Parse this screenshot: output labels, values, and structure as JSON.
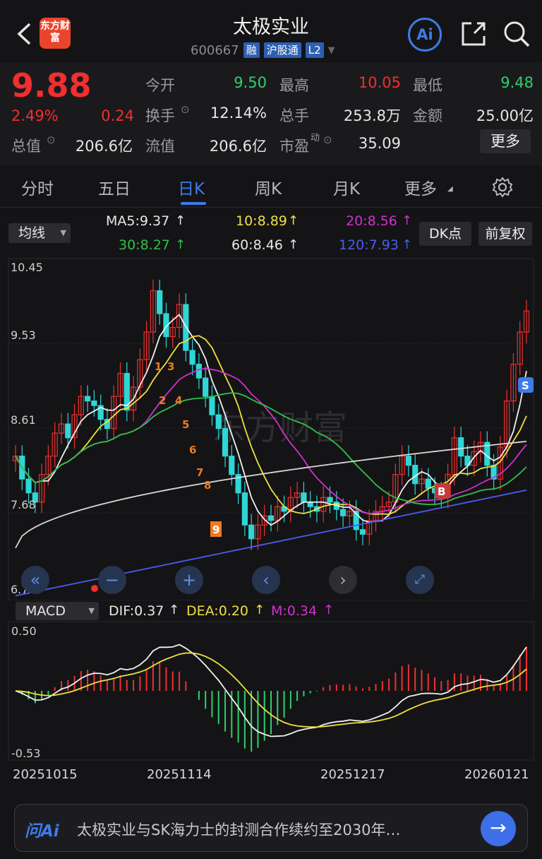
{
  "header": {
    "title": "太极实业",
    "code": "600667",
    "tags": [
      "融",
      "沪股通",
      "L2"
    ],
    "logo": "东方财富",
    "ai_label": "Ai"
  },
  "quote": {
    "price": "9.88",
    "change_pct": "2.49%",
    "change": "0.24",
    "open_label": "今开",
    "open": "9.50",
    "high_label": "最高",
    "high": "10.05",
    "low_label": "最低",
    "low": "9.48",
    "turnover_label": "换手",
    "turnover": "12.14%",
    "volume_label": "总手",
    "volume": "253.8万",
    "amount_label": "金额",
    "amount": "25.00亿",
    "mcap_label": "总值",
    "mcap": "206.6亿",
    "float_label": "流值",
    "float": "206.6亿",
    "pe_label": "市盈",
    "pe_sup": "动",
    "pe": "35.09",
    "more": "更多"
  },
  "tabs": [
    "分时",
    "五日",
    "日K",
    "周K",
    "月K",
    "更多"
  ],
  "ma_selector": "均线",
  "ma": {
    "ma5": "MA5:9.37",
    "ma10": "10:8.89",
    "ma20": "20:8.56",
    "ma30": "30:8.27",
    "ma60": "60:8.46",
    "ma120": "120:7.93"
  },
  "buttons": {
    "dk": "DK点",
    "fq": "前复权"
  },
  "kchart": {
    "yticks": [
      "10.45",
      "9.53",
      "8.61",
      "7.68",
      "6.76"
    ],
    "signals": [
      "1",
      "2",
      "3",
      "4",
      "5",
      "6",
      "7",
      "8",
      "9"
    ],
    "buy": "B",
    "sell": "S",
    "watermark": "东方财富"
  },
  "macd": {
    "selector": "MACD",
    "dif": "DIF:0.37",
    "dea": "DEA:0.20",
    "m": "M:0.34",
    "ytop": "0.50",
    "ybot": "-0.53"
  },
  "dates": [
    "20251015",
    "20251114",
    "20251217",
    "20260121"
  ],
  "ai": {
    "logo": "问Ai",
    "text": "太极实业与SK海力士的封测合作续约至2030年…"
  },
  "colors": {
    "up": "#f02f2f",
    "down": "#2fd6d6",
    "accent": "#3d7be8"
  },
  "chart_data": {
    "type": "candlestick",
    "x_start": "20251015",
    "x_end": "20260121",
    "ylim": [
      6.76,
      10.45
    ],
    "closes": [
      8.3,
      8.05,
      7.9,
      7.8,
      8.1,
      8.3,
      8.55,
      8.65,
      8.5,
      8.75,
      8.95,
      8.9,
      8.85,
      8.7,
      8.6,
      8.95,
      9.2,
      8.8,
      9.05,
      9.35,
      9.65,
      10.1,
      9.85,
      9.6,
      9.7,
      9.95,
      9.45,
      9.3,
      9.15,
      8.95,
      8.75,
      8.6,
      8.3,
      8.1,
      7.9,
      7.55,
      7.4,
      7.55,
      7.65,
      7.6,
      7.75,
      7.7,
      7.85,
      7.9,
      7.8,
      7.75,
      7.7,
      7.85,
      7.8,
      7.72,
      7.65,
      7.7,
      7.5,
      7.45,
      7.6,
      7.7,
      7.75,
      7.8,
      8.1,
      8.3,
      8.2,
      8.0,
      8.05,
      7.95,
      7.9,
      7.85,
      8.1,
      8.5,
      8.3,
      8.2,
      8.35,
      8.45,
      8.2,
      8.05,
      8.4,
      8.9,
      9.3,
      9.65,
      9.88
    ]
  }
}
